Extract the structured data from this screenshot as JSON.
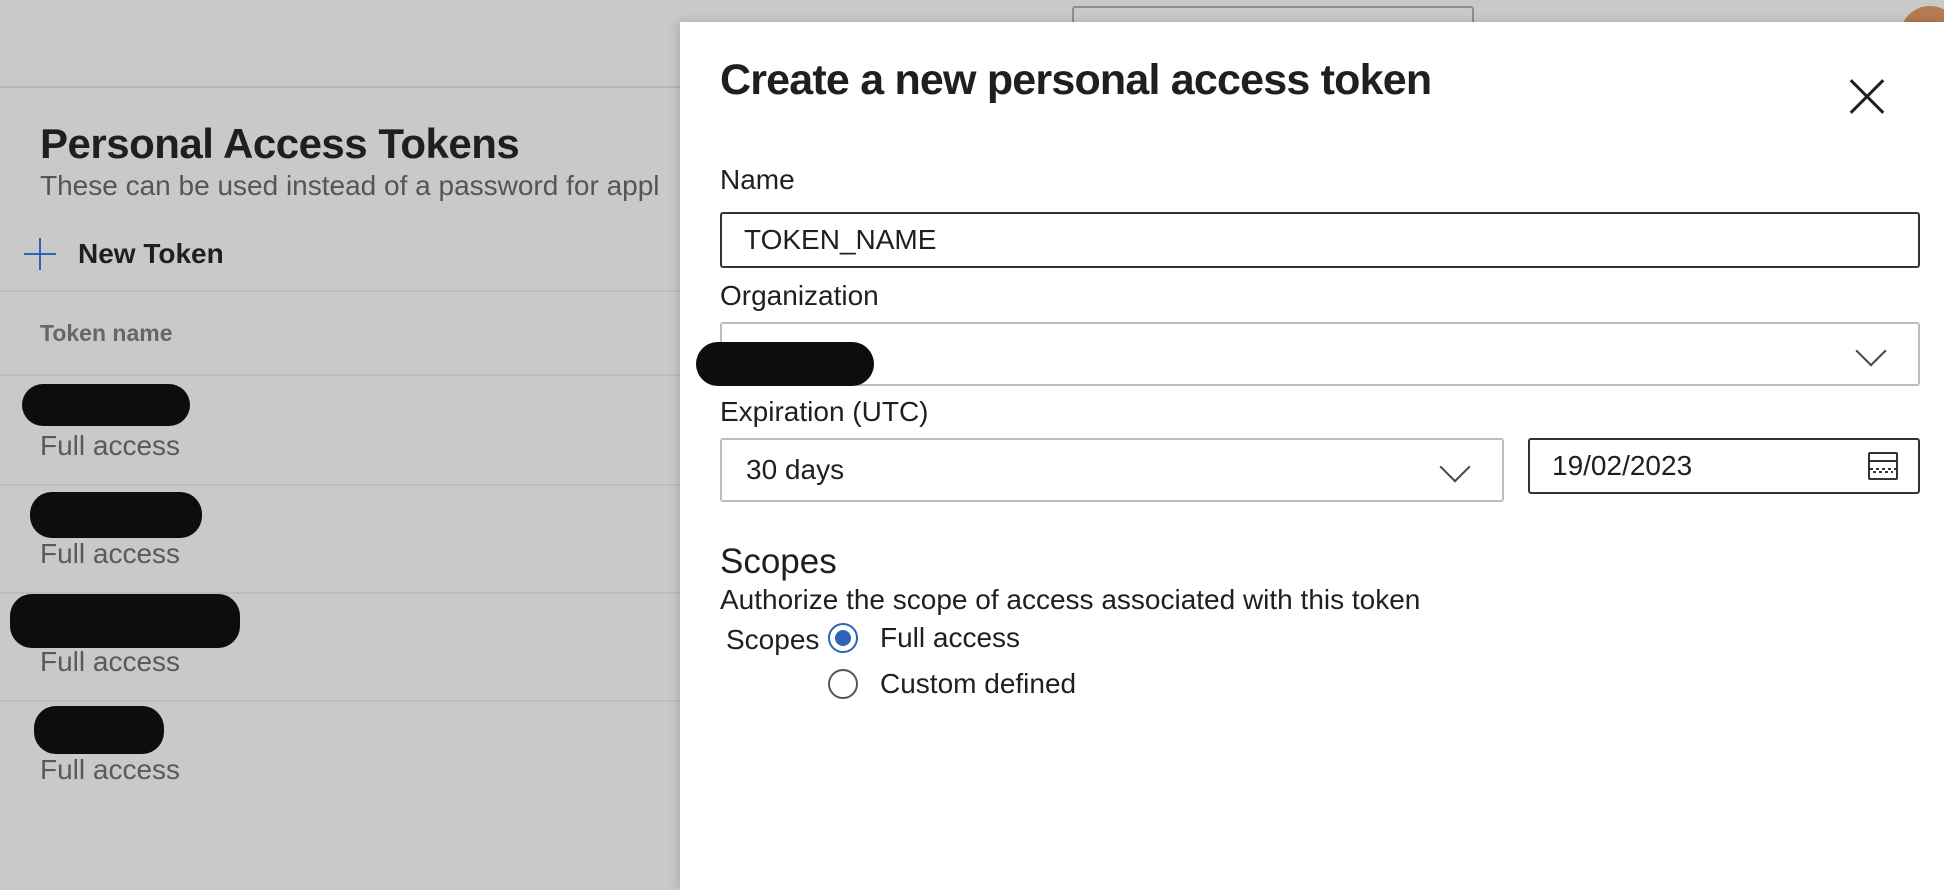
{
  "background": {
    "page_title": "Personal Access Tokens",
    "page_subtitle": "These can be used instead of a password for appl",
    "new_token_label": "New Token",
    "column_header": "Token name",
    "rows": [
      {
        "access": "Full access"
      },
      {
        "access": "Full access"
      },
      {
        "access": "Full access"
      },
      {
        "access": "Full access"
      }
    ]
  },
  "panel": {
    "title": "Create a new personal access token",
    "name_label": "Name",
    "name_value": "TOKEN_NAME",
    "organization_label": "Organization",
    "organization_value": "",
    "expiration_label": "Expiration (UTC)",
    "expiration_value": "30 days",
    "expiration_date": "19/02/2023",
    "scopes_heading": "Scopes",
    "scopes_description": "Authorize the scope of access associated with this token",
    "scopes_label": "Scopes",
    "scope_options": [
      {
        "label": "Full access",
        "checked": true
      },
      {
        "label": "Custom defined",
        "checked": false
      }
    ]
  },
  "colors": {
    "accent": "#2a63b8",
    "overlay_background": "#c9c9c9",
    "redaction": "#0d0d0d"
  },
  "icons": [
    "plus-icon",
    "close-icon",
    "chevron-down-icon",
    "calendar-icon",
    "radio-checked-icon",
    "radio-unchecked-icon"
  ]
}
